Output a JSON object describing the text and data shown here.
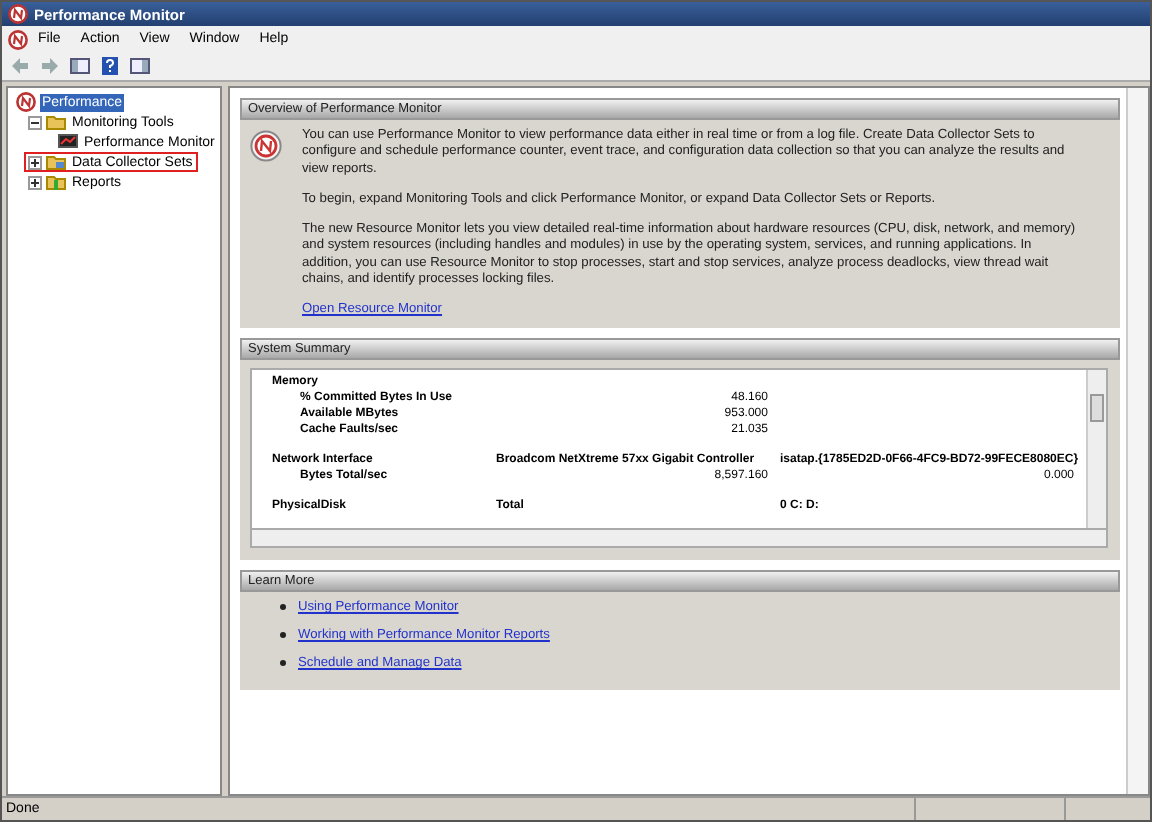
{
  "window": {
    "title": "Performance Monitor"
  },
  "menu": [
    {
      "label": "File"
    },
    {
      "label": "Action"
    },
    {
      "label": "View"
    },
    {
      "label": "Window"
    },
    {
      "label": "Help"
    }
  ],
  "toolbar": [
    {
      "kind": "back",
      "disabled": true
    },
    {
      "kind": "forward",
      "disabled": true
    },
    {
      "kind": "pane",
      "disabled": false
    },
    {
      "kind": "help",
      "disabled": false
    },
    {
      "kind": "panel",
      "disabled": false
    }
  ],
  "tree": [
    {
      "label": "Performance",
      "kind": "root",
      "selected": true,
      "highlighted": false,
      "children": [
        {
          "label": "Monitoring Tools",
          "kind": "tools",
          "selected": false,
          "highlighted": false,
          "expanded": true,
          "children": [
            {
              "label": "Performance Monitor",
              "kind": "monitor",
              "selected": false,
              "highlighted": false
            }
          ]
        },
        {
          "label": "Data Collector Sets",
          "kind": "sets",
          "selected": false,
          "highlighted": true,
          "expanded": false
        },
        {
          "label": "Reports",
          "kind": "reports",
          "selected": false,
          "highlighted": false,
          "expanded": false
        }
      ]
    }
  ],
  "overview": {
    "title": "Overview of Performance Monitor",
    "paragraphs": [
      "You can use Performance Monitor to view performance data either in real time or from a log file. Create Data Collector Sets to configure and schedule performance counter, event trace, and configuration data collection so that you can analyze the results and view reports.",
      "To begin, expand Monitoring Tools and click Performance Monitor, or expand Data Collector Sets or Reports.",
      "The new Resource Monitor lets you view detailed real-time information about hardware resources (CPU, disk, network, and memory) and system resources (including handles and modules) in use by the operating system, services, and running applications. In addition, you can use Resource Monitor to stop processes, start and stop services, analyze process deadlocks, view thread wait chains, and identify processes locking files."
    ],
    "link": "Open Resource Monitor"
  },
  "summary": {
    "title": "System Summary",
    "rows": [
      {
        "kind": "group",
        "cells": [
          "Memory"
        ]
      },
      {
        "kind": "counter",
        "cells": [
          "% Committed Bytes In Use",
          "48.160"
        ]
      },
      {
        "kind": "counter",
        "cells": [
          "Available MBytes",
          "953.000"
        ]
      },
      {
        "kind": "counter",
        "cells": [
          "Cache Faults/sec",
          "21.035"
        ]
      },
      {
        "kind": "spacer",
        "cells": []
      },
      {
        "kind": "group",
        "cells": [
          "Network Interface",
          "Broadcom NetXtreme 57xx Gigabit Controller",
          "isatap.{1785ED2D-0F66-4FC9-BD72-99FECE8080EC}"
        ]
      },
      {
        "kind": "counter",
        "cells": [
          "Bytes Total/sec",
          "8,597.160",
          "0.000"
        ]
      },
      {
        "kind": "spacer",
        "cells": []
      },
      {
        "kind": "group",
        "cells": [
          "PhysicalDisk",
          "Total",
          "0 C: D:"
        ]
      }
    ]
  },
  "learn_more": {
    "title": "Learn More",
    "links": [
      "Using Performance Monitor",
      "Working with Performance Monitor Reports",
      "Schedule and Manage Data"
    ]
  },
  "status_bar": {
    "text": "Done"
  }
}
